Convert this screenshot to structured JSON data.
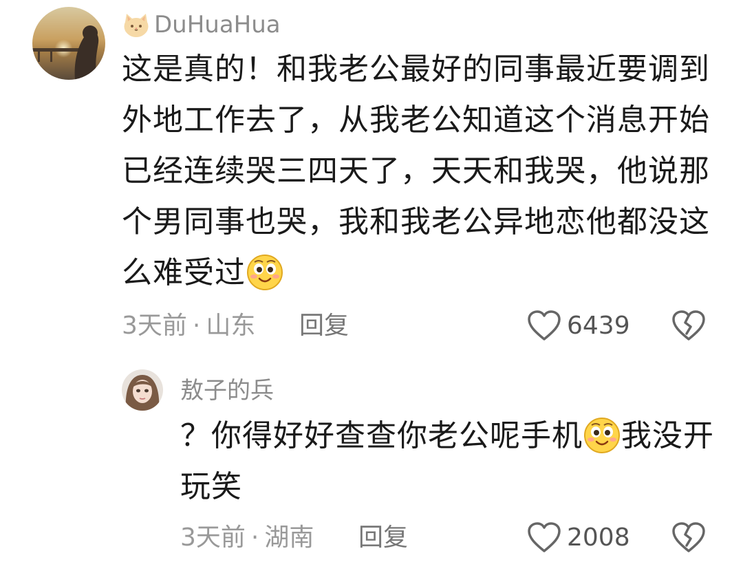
{
  "comments": [
    {
      "username": "DuHuaHua",
      "text_lines": [
        "这是真的！和我老公最好的同事最近要调到",
        "外地工作去了，从我老公知道这个消息开始",
        "已经连续哭三四天了，天天和我哭，他说那",
        "个男同事也哭，我和我老公异地恋他都没这",
        "么难受过"
      ],
      "time": "3天前",
      "location": "山东",
      "reply_label": "回复",
      "likes": "6439",
      "badge_icon": "cat-icon",
      "emoji_icon": "smiley-emoji-icon"
    },
    {
      "username": "敖子的兵",
      "text_lines": [
        "？你得好好查查你老公呢手机",
        "我没开",
        "玩笑"
      ],
      "time": "3天前",
      "location": "湖南",
      "reply_label": "回复",
      "likes": "2008",
      "emoji_icon": "smiley-emoji-icon"
    }
  ],
  "meta_separator": "·",
  "colors": {
    "text": "#1a1a1a",
    "muted": "#999999",
    "username": "#8c8c8c"
  }
}
